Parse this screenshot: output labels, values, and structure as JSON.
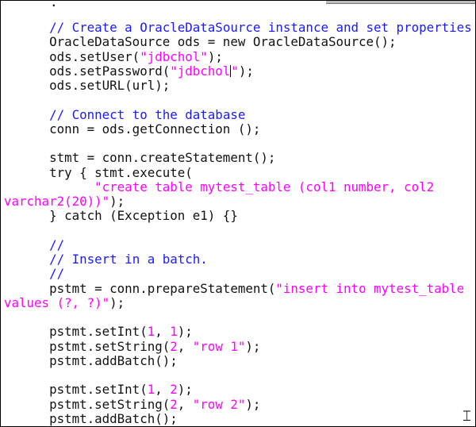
{
  "top_partial": ".",
  "lines": [
    [
      {
        "t": "      "
      },
      {
        "t": "// Create a OracleDataSource instance and set properties",
        "c": "comment"
      }
    ],
    [
      {
        "t": "      OracleDataSource ods = new OracleDataSource();"
      }
    ],
    [
      {
        "t": "      ods.setUser("
      },
      {
        "t": "\"jdbchol\"",
        "c": "str"
      },
      {
        "t": ");"
      }
    ],
    [
      {
        "t": "      ods.setPassword("
      },
      {
        "t": "\"jdbchol",
        "c": "str"
      },
      {
        "caret": true
      },
      {
        "t": "\"",
        "c": "str"
      },
      {
        "t": ");"
      }
    ],
    [
      {
        "t": "      ods.setURL(url);"
      }
    ],
    [],
    [
      {
        "t": "      "
      },
      {
        "t": "// Connect to the database",
        "c": "comment"
      }
    ],
    [
      {
        "t": "      conn = ods.getConnection ();"
      }
    ],
    [],
    [
      {
        "t": "      stmt = conn.createStatement();"
      }
    ],
    [
      {
        "t": "      try { stmt.execute("
      }
    ],
    [
      {
        "t": "            "
      },
      {
        "t": "\"create table mytest_table (col1 number, col2",
        "c": "str"
      }
    ],
    [
      {
        "t": "varchar2(20))\"",
        "c": "str"
      },
      {
        "t": ");"
      }
    ],
    [
      {
        "t": "      } catch (Exception e1) {}"
      }
    ],
    [],
    [
      {
        "t": "      "
      },
      {
        "t": "//",
        "c": "comment"
      }
    ],
    [
      {
        "t": "      "
      },
      {
        "t": "// Insert in a batch.",
        "c": "comment"
      }
    ],
    [
      {
        "t": "      "
      },
      {
        "t": "//",
        "c": "comment"
      }
    ],
    [
      {
        "t": "      pstmt = conn.prepareStatement("
      },
      {
        "t": "\"insert into mytest_table",
        "c": "str"
      }
    ],
    [
      {
        "t": "values (?, ?)\"",
        "c": "str"
      },
      {
        "t": ");"
      }
    ],
    [],
    [
      {
        "t": "      pstmt.setInt("
      },
      {
        "t": "1",
        "c": "num"
      },
      {
        "t": ", "
      },
      {
        "t": "1",
        "c": "num"
      },
      {
        "t": ");"
      }
    ],
    [
      {
        "t": "      pstmt.setString("
      },
      {
        "t": "2",
        "c": "num"
      },
      {
        "t": ", "
      },
      {
        "t": "\"row 1\"",
        "c": "str"
      },
      {
        "t": ");"
      }
    ],
    [
      {
        "t": "      pstmt.addBatch();"
      }
    ],
    [],
    [
      {
        "t": "      pstmt.setInt("
      },
      {
        "t": "1",
        "c": "num"
      },
      {
        "t": ", "
      },
      {
        "t": "2",
        "c": "num"
      },
      {
        "t": ");"
      }
    ],
    [
      {
        "t": "      pstmt.setString("
      },
      {
        "t": "2",
        "c": "num"
      },
      {
        "t": ", "
      },
      {
        "t": "\"row 2\"",
        "c": "str"
      },
      {
        "t": ");"
      }
    ],
    [
      {
        "t": "      pstmt.addBatch();"
      }
    ]
  ],
  "colors": {
    "comment": "#1a1aff",
    "string": "#ff00ff",
    "text": "#111111"
  },
  "cursor_icon": "i-beam-icon"
}
